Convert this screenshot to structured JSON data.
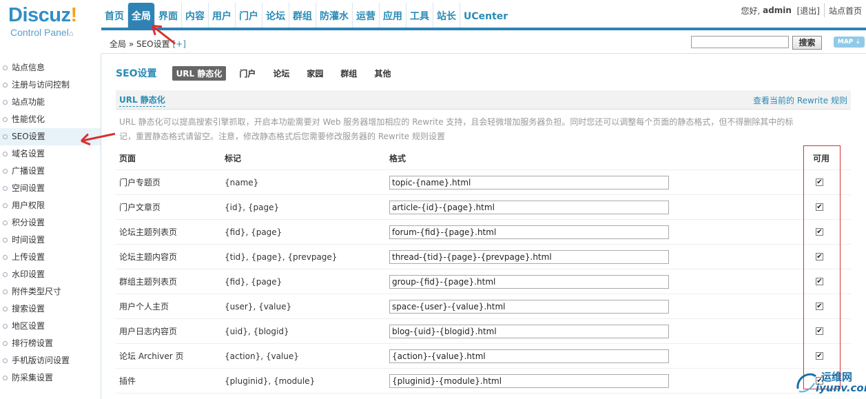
{
  "header": {
    "logo_word": "Discuz",
    "logo_bang": "!",
    "logo_sub": "Control Panel",
    "nav": [
      {
        "label": "首页",
        "active": false
      },
      {
        "label": "全局",
        "active": true
      },
      {
        "label": "界面",
        "active": false
      },
      {
        "label": "内容",
        "active": false
      },
      {
        "label": "用户",
        "active": false
      },
      {
        "label": "门户",
        "active": false
      },
      {
        "label": "论坛",
        "active": false
      },
      {
        "label": "群组",
        "active": false
      },
      {
        "label": "防灌水",
        "active": false
      },
      {
        "label": "运营",
        "active": false
      },
      {
        "label": "应用",
        "active": false
      },
      {
        "label": "工具",
        "active": false
      },
      {
        "label": "站长",
        "active": false
      },
      {
        "label": "UCenter",
        "active": false
      }
    ],
    "greeting": "您好,",
    "username": "admin",
    "logout": "[退出]",
    "home_link": "站点首页"
  },
  "subbar": {
    "breadcrumb": "全局 » SEO设置",
    "breadcrumb_plus": "[+]",
    "search_button": "搜索",
    "map_button": "MAP ⇣"
  },
  "sidebar": {
    "items": [
      "站点信息",
      "注册与访问控制",
      "站点功能",
      "性能优化",
      "SEO设置",
      "域名设置",
      "广播设置",
      "空间设置",
      "用户权限",
      "积分设置",
      "时间设置",
      "上传设置",
      "水印设置",
      "附件类型尺寸",
      "搜索设置",
      "地区设置",
      "排行榜设置",
      "手机版访问设置",
      "防采集设置"
    ],
    "active": "SEO设置"
  },
  "main": {
    "title": "SEO设置",
    "tabs": [
      "URL 静态化",
      "门户",
      "论坛",
      "家园",
      "群组",
      "其他"
    ],
    "section_title": "URL 静态化",
    "rewrite_link": "查看当前的 Rewrite 规则",
    "description": "URL 静态化可以提高搜索引擎抓取，开启本功能需要对 Web 服务器增加相应的 Rewrite 支持，且会轻微增加服务器负担。同时您还可以调整每个页面的静态格式，但不得删除其中的标记，重置静态格式请留空。注意，修改静态格式后您需要修改服务器的 Rewrite 规则设置",
    "columns": [
      "页面",
      "标记",
      "格式",
      "可用"
    ],
    "rows": [
      {
        "page": "门户专题页",
        "mark": "{name}",
        "format": "topic-{name}.html",
        "enabled": true
      },
      {
        "page": "门户文章页",
        "mark": "{id}, {page}",
        "format": "article-{id}-{page}.html",
        "enabled": true
      },
      {
        "page": "论坛主题列表页",
        "mark": "{fid}, {page}",
        "format": "forum-{fid}-{page}.html",
        "enabled": true
      },
      {
        "page": "论坛主题内容页",
        "mark": "{tid}, {page}, {prevpage}",
        "format": "thread-{tid}-{page}-{prevpage}.html",
        "enabled": true
      },
      {
        "page": "群组主题列表页",
        "mark": "{fid}, {page}",
        "format": "group-{fid}-{page}.html",
        "enabled": true
      },
      {
        "page": "用户个人主页",
        "mark": "{user}, {value}",
        "format": "space-{user}-{value}.html",
        "enabled": true
      },
      {
        "page": "用户日志内容页",
        "mark": "{uid}, {blogid}",
        "format": "blog-{uid}-{blogid}.html",
        "enabled": true
      },
      {
        "page": "论坛 Archiver 页",
        "mark": "{action}, {value}",
        "format": "{action}-{value}.html",
        "enabled": true
      },
      {
        "page": "插件",
        "mark": "{pluginid}, {module}",
        "format": "{pluginid}-{module}.html",
        "enabled": true
      }
    ]
  },
  "watermark": {
    "text": "运维网",
    "url": "iyunv.com"
  },
  "colors": {
    "accent": "#2e83b4",
    "link": "#2a8bb6",
    "annotation": "#d8302f"
  }
}
